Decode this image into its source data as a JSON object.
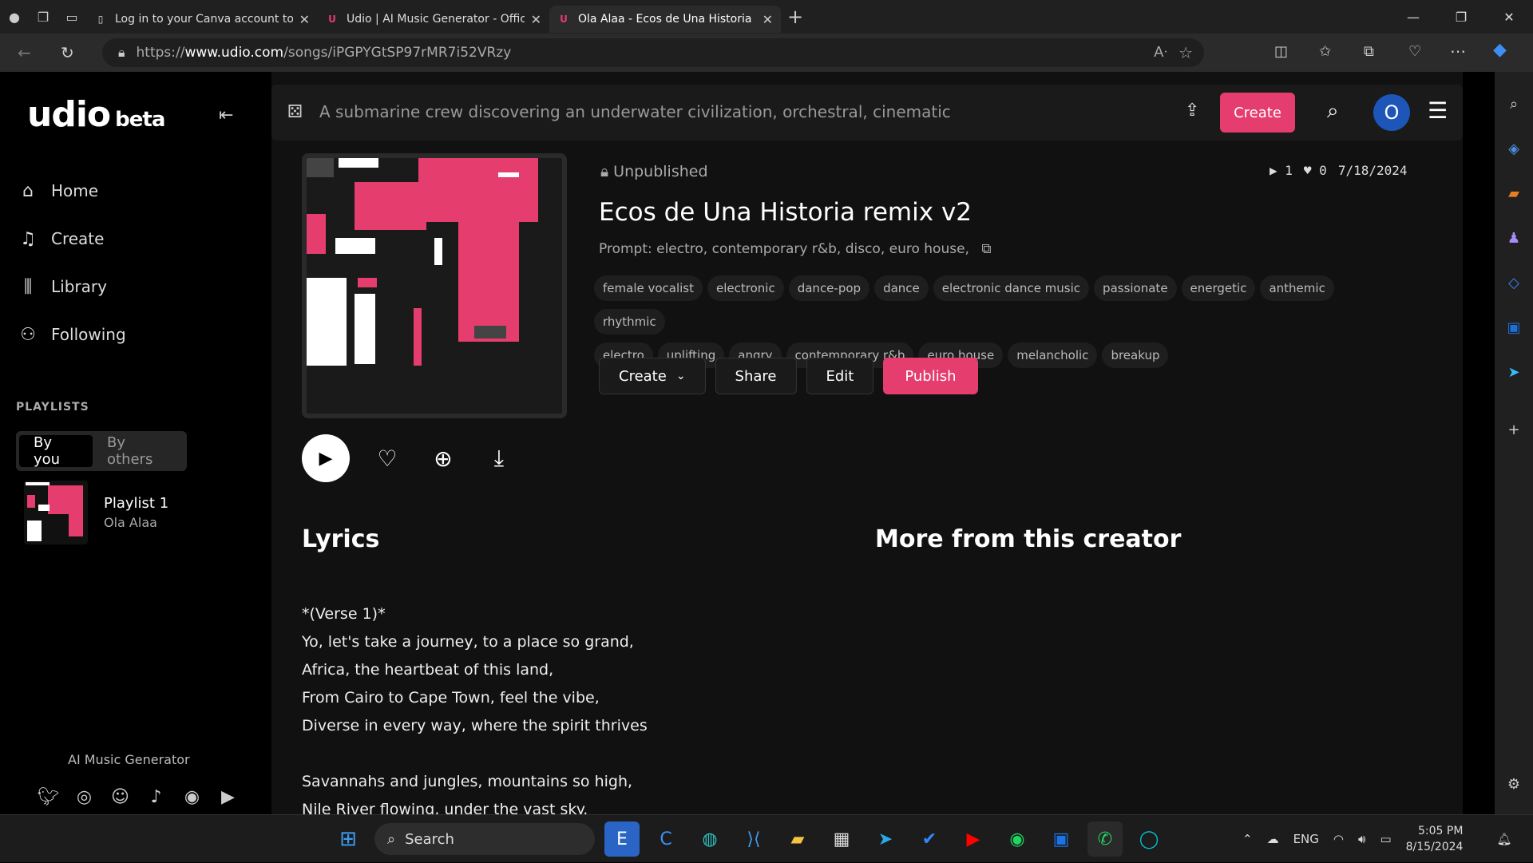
{
  "browser": {
    "tabs": [
      {
        "title": "Log in to your Canva account to"
      },
      {
        "title": "Udio | AI Music Generator - Offic"
      },
      {
        "title": "Ola Alaa - Ecos de Una Historia r"
      }
    ],
    "url_prefix": "https://",
    "url_domain": "www.udio.com",
    "url_path": "/songs/iPGPYGtSP97rMR7i52VRzy"
  },
  "sidebar": {
    "logo": "udio",
    "logo_sub": "beta",
    "nav": [
      {
        "label": "Home"
      },
      {
        "label": "Create"
      },
      {
        "label": "Library"
      },
      {
        "label": "Following"
      }
    ],
    "playlists_heading": "PLAYLISTS",
    "playlist_tabs": [
      "By you",
      "By others"
    ],
    "playlist": {
      "name": "Playlist 1",
      "owner": "Ola Alaa"
    },
    "footer": "AI Music Generator"
  },
  "topbar": {
    "prompt_placeholder": "A submarine crew discovering an underwater civilization, orchestral, cinematic",
    "create_label": "Create",
    "avatar_letter": "O"
  },
  "song": {
    "status": "Unpublished",
    "plays": "1",
    "likes": "0",
    "date": "7/18/2024",
    "title": "Ecos de Una Historia remix v2",
    "prompt": "Prompt: electro, contemporary r&b, disco, euro house,",
    "tags": [
      "female vocalist",
      "electronic",
      "dance-pop",
      "dance",
      "electronic dance music",
      "passionate",
      "energetic",
      "anthemic",
      "rhythmic",
      "electro",
      "uplifting",
      "angry",
      "contemporary r&b",
      "euro house",
      "melancholic",
      "breakup"
    ],
    "actions": {
      "create": "Create",
      "share": "Share",
      "edit": "Edit",
      "publish": "Publish"
    }
  },
  "sections": {
    "lyrics_heading": "Lyrics",
    "more_heading": "More from this creator"
  },
  "lyrics": [
    "*(Verse 1)*",
    "Yo, let's take a journey, to a place so grand,",
    "Africa, the heartbeat of this land,",
    "From Cairo to Cape Town, feel the vibe,",
    "Diverse in every way, where the spirit thrives",
    "",
    "Savannahs and jungles, mountains so high,",
    "Nile River flowing, under the vast sky."
  ],
  "taskbar": {
    "search": "Search",
    "lang": "ENG",
    "time": "5:05 PM",
    "date": "8/15/2024"
  },
  "colors": {
    "accent": "#e43d6e",
    "avatar": "#1d55b8"
  }
}
